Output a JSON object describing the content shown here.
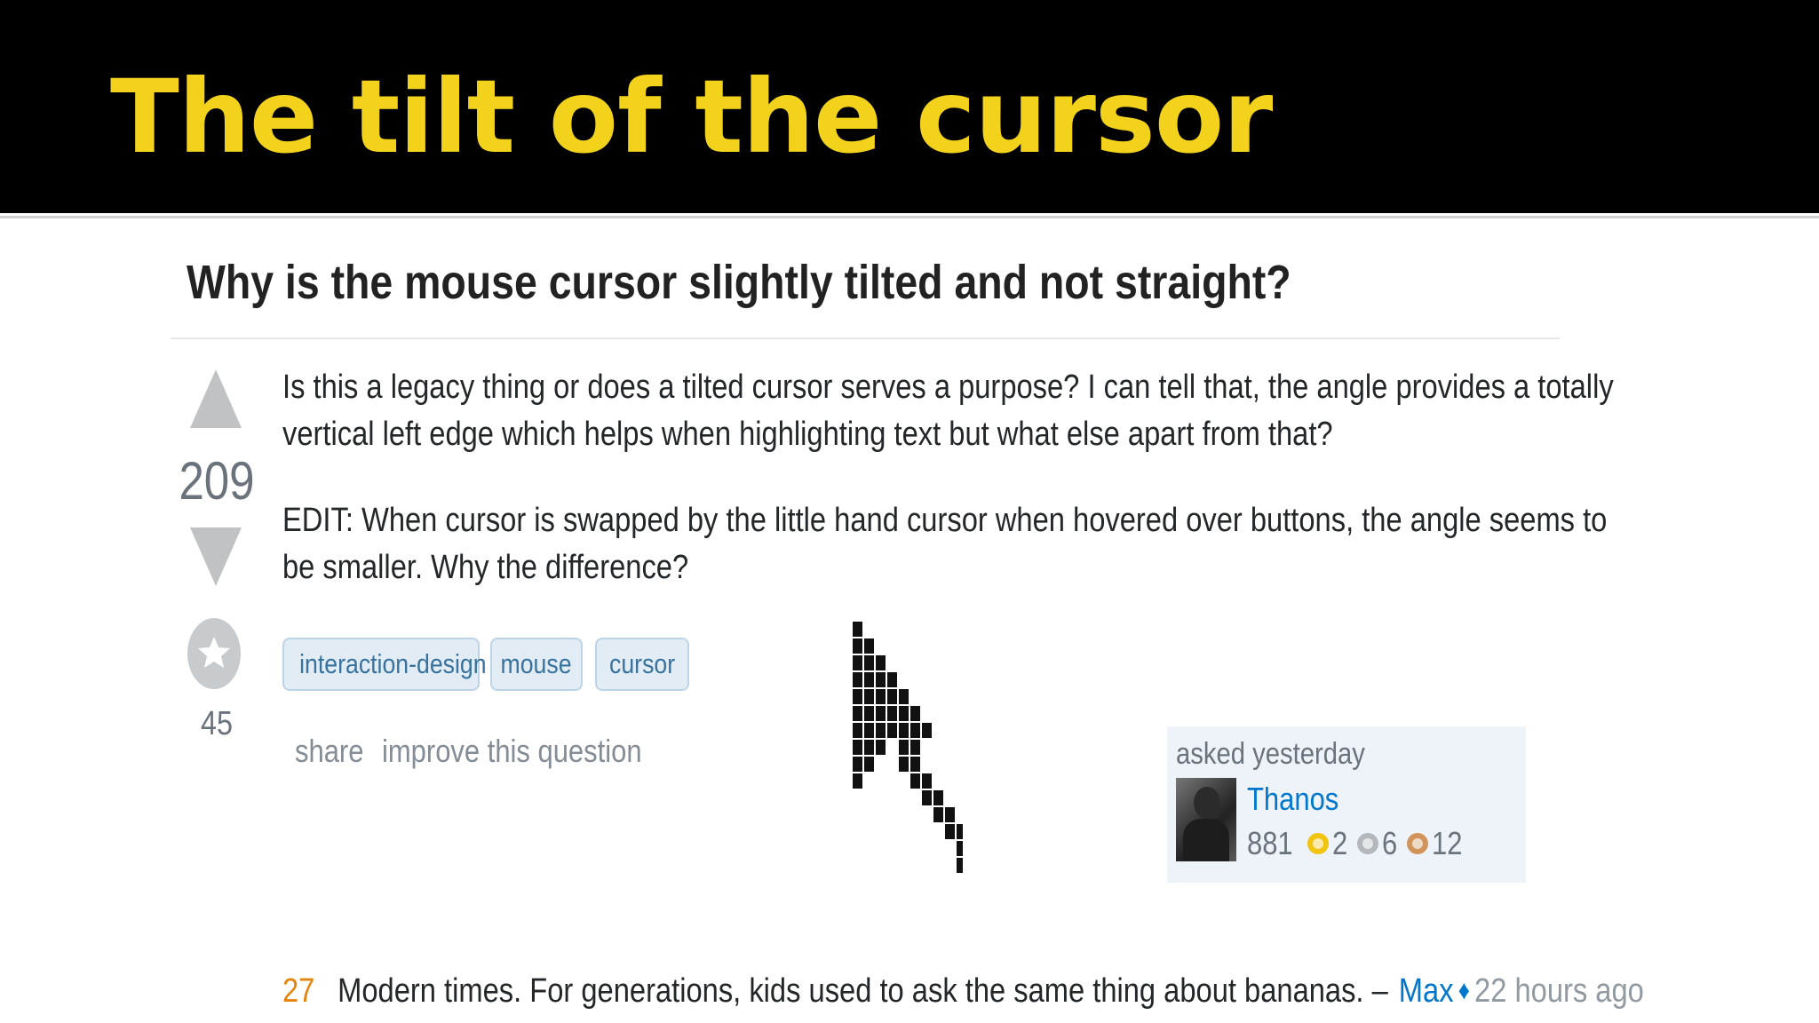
{
  "slide": {
    "title": "The tilt of the cursor"
  },
  "question": {
    "title": "Why is the mouse cursor slightly tilted and not straight?",
    "votes": "209",
    "favorites": "45",
    "body_lines": [
      "Is this a legacy thing or does a tilted cursor serves a purpose? I can tell that, the angle provides a totally",
      "vertical left edge which helps when highlighting text but what else apart from that?",
      "EDIT: When cursor is swapped by the little hand cursor when hovered over buttons, the angle seems to",
      "be smaller. Why the difference?"
    ],
    "tags": [
      "interaction-design",
      "mouse",
      "cursor"
    ],
    "links": {
      "share": "share",
      "improve": "improve this question"
    }
  },
  "user_card": {
    "asked": "asked yesterday",
    "username": "Thanos",
    "reputation": "881",
    "gold_badges": "2",
    "silver_badges": "6",
    "bronze_badges": "12"
  },
  "comment": {
    "score": "27",
    "text": "Modern times. For generations, kids used to ask the same thing about bananas. –",
    "author": "Max",
    "diamond": "♦",
    "time": "22 hours ago"
  },
  "icons": {
    "vote_up": "arrow-up-icon",
    "vote_down": "arrow-down-icon",
    "favorite": "star-icon",
    "cursor_illustration": "pixel-cursor-icon"
  },
  "colors": {
    "slide_title": "#f2d21b",
    "slide_header_bg": "#000000",
    "link_blue": "#0077cc",
    "tag_bg": "#e1ecf4",
    "comment_score": "#e4840c"
  }
}
